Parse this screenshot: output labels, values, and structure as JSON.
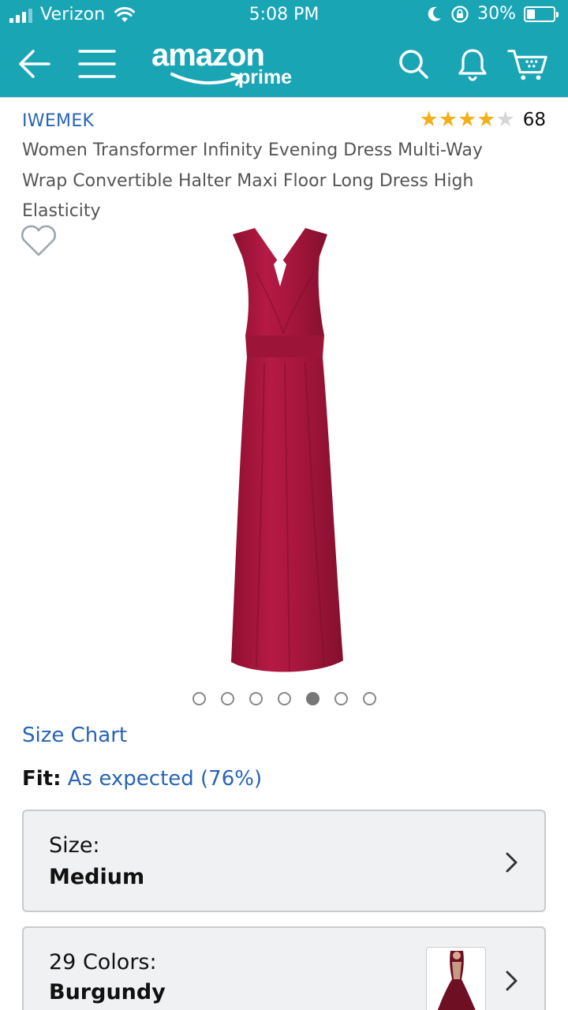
{
  "status_bar": {
    "carrier": "Verizon",
    "time": "5:08 PM",
    "battery": "30%"
  },
  "nav": {
    "logo_text": "amazon",
    "logo_sub": "prime",
    "colors": {
      "header_bg": "#1aa5b5",
      "link": "#2864b4",
      "star": "#f4b01b"
    }
  },
  "product": {
    "brand": "IWEMEK",
    "rating": 4.5,
    "review_count": "68",
    "title": "Women Transformer Infinity Evening Dress Multi-Way Wrap Convertible Halter Maxi Floor Long Dress High Elasticity",
    "image_count": 7,
    "active_image": 5
  },
  "size_chart": {
    "label": "Size Chart"
  },
  "fit": {
    "label": "Fit:",
    "value": "As expected (76%)"
  },
  "size_selector": {
    "label": "Size:",
    "value": "Medium"
  },
  "color_selector": {
    "label": "29 Colors:",
    "value": "Burgundy"
  }
}
